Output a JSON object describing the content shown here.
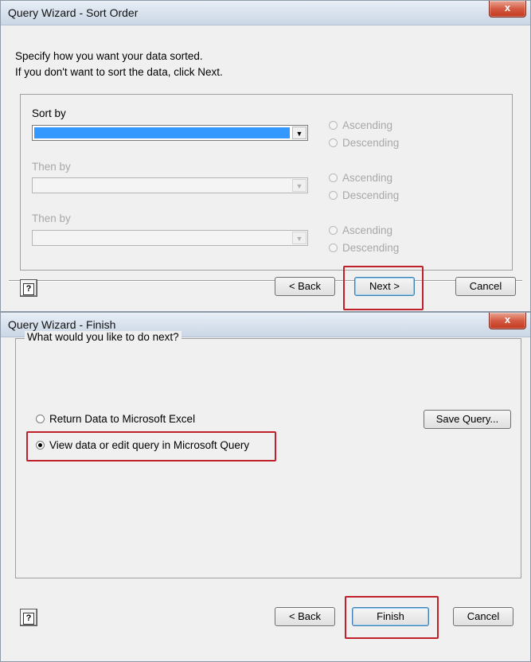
{
  "sort_dialog": {
    "title": "Query Wizard - Sort Order",
    "close_label": "x",
    "instructions": [
      "Specify how you want your data sorted.",
      "If you don't want to sort the data, click Next."
    ],
    "sort_by_label": "Sort by",
    "then_by_1_label": "Then by",
    "then_by_2_label": "Then by",
    "ascending_label": "Ascending",
    "descending_label": "Descending",
    "buttons": {
      "help": "?",
      "back": "< Back",
      "next": "Next >",
      "cancel": "Cancel"
    }
  },
  "finish_dialog": {
    "title": "Query Wizard - Finish",
    "close_label": "x",
    "group_caption": "What would you like to do next?",
    "option_return": "Return Data to Microsoft Excel",
    "option_view": "View data or edit query in Microsoft Query",
    "selected_option": "option_view",
    "save_query_label": "Save Query...",
    "buttons": {
      "help": "?",
      "back": "< Back",
      "finish": "Finish",
      "cancel": "Cancel"
    }
  },
  "colors": {
    "highlight": "#c0202a",
    "selection": "#3399ff",
    "close_button": "#d65a42"
  }
}
